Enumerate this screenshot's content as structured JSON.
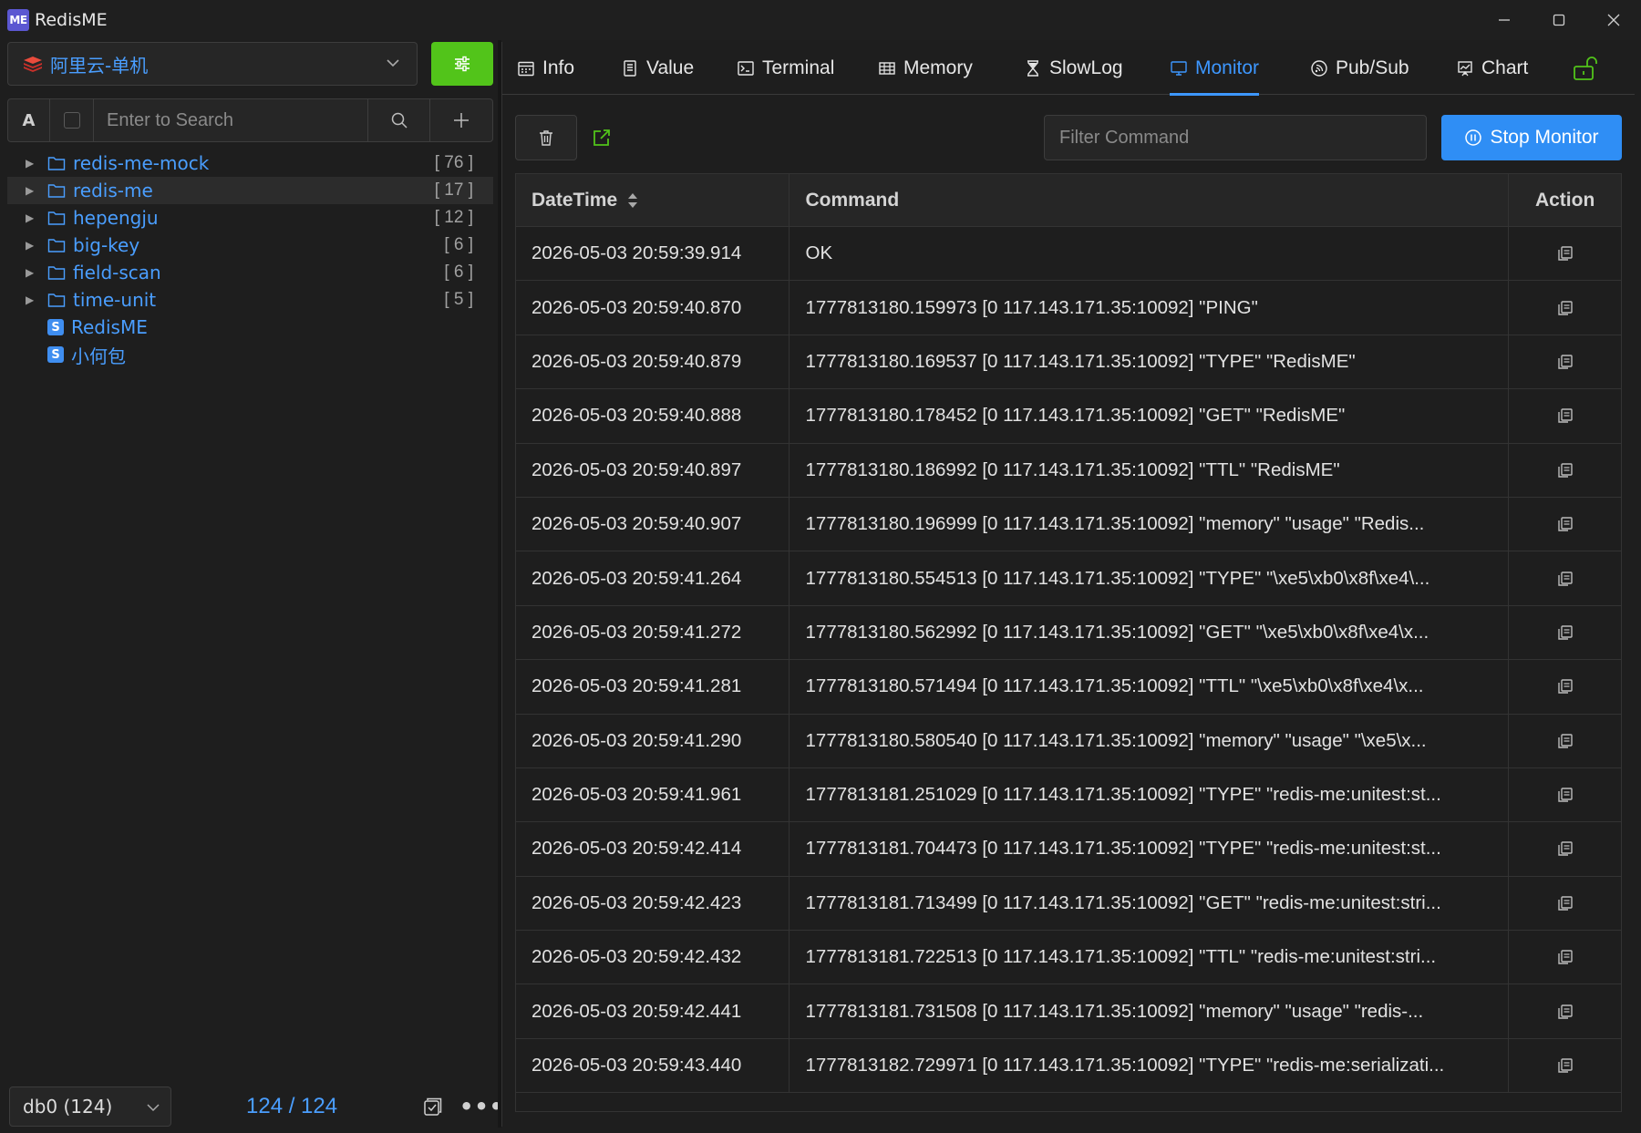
{
  "app": {
    "title": "RedisME",
    "logo_text": "ME"
  },
  "connection": {
    "label": "阿里云-单机"
  },
  "search": {
    "case_toggle": "A",
    "placeholder": "Enter to Search"
  },
  "tree": [
    {
      "type": "folder",
      "label": "redis-me-mock",
      "count": "[ 76 ]"
    },
    {
      "type": "folder",
      "label": "redis-me",
      "count": "[ 17 ]",
      "selected": true
    },
    {
      "type": "folder",
      "label": "hepengju",
      "count": "[ 12 ]"
    },
    {
      "type": "folder",
      "label": "big-key",
      "count": "[ 6 ]"
    },
    {
      "type": "folder",
      "label": "field-scan",
      "count": "[ 6 ]"
    },
    {
      "type": "folder",
      "label": "time-unit",
      "count": "[ 5 ]"
    },
    {
      "type": "string",
      "label": "RedisME",
      "badge": "S"
    },
    {
      "type": "string",
      "label": "小何包",
      "badge": "S"
    }
  ],
  "footer": {
    "db_label": "db0 (124)",
    "key_count": "124 / 124"
  },
  "tabs": [
    {
      "label": "Info",
      "icon": "calendar-icon"
    },
    {
      "label": "Value",
      "icon": "document-icon"
    },
    {
      "label": "Terminal",
      "icon": "terminal-icon"
    },
    {
      "label": "Memory",
      "icon": "memory-icon"
    },
    {
      "label": "SlowLog",
      "icon": "hourglass-icon"
    },
    {
      "label": "Monitor",
      "icon": "monitor-icon",
      "active": true
    },
    {
      "label": "Pub/Sub",
      "icon": "broadcast-icon"
    },
    {
      "label": "Chart",
      "icon": "chart-icon"
    }
  ],
  "monitor": {
    "filter_placeholder": "Filter Command",
    "stop_label": "Stop Monitor",
    "columns": {
      "datetime": "DateTime",
      "command": "Command",
      "action": "Action"
    },
    "rows": [
      {
        "datetime": "2026-05-03 20:59:39.914",
        "command": "OK"
      },
      {
        "datetime": "2026-05-03 20:59:40.870",
        "command": "1777813180.159973 [0 117.143.171.35:10092] \"PING\""
      },
      {
        "datetime": "2026-05-03 20:59:40.879",
        "command": "1777813180.169537 [0 117.143.171.35:10092] \"TYPE\" \"RedisME\""
      },
      {
        "datetime": "2026-05-03 20:59:40.888",
        "command": "1777813180.178452 [0 117.143.171.35:10092] \"GET\" \"RedisME\""
      },
      {
        "datetime": "2026-05-03 20:59:40.897",
        "command": "1777813180.186992 [0 117.143.171.35:10092] \"TTL\" \"RedisME\""
      },
      {
        "datetime": "2026-05-03 20:59:40.907",
        "command": "1777813180.196999 [0 117.143.171.35:10092] \"memory\" \"usage\" \"Redis..."
      },
      {
        "datetime": "2026-05-03 20:59:41.264",
        "command": "1777813180.554513 [0 117.143.171.35:10092] \"TYPE\" \"\\xe5\\xb0\\x8f\\xe4\\..."
      },
      {
        "datetime": "2026-05-03 20:59:41.272",
        "command": "1777813180.562992 [0 117.143.171.35:10092] \"GET\" \"\\xe5\\xb0\\x8f\\xe4\\x..."
      },
      {
        "datetime": "2026-05-03 20:59:41.281",
        "command": "1777813180.571494 [0 117.143.171.35:10092] \"TTL\" \"\\xe5\\xb0\\x8f\\xe4\\x..."
      },
      {
        "datetime": "2026-05-03 20:59:41.290",
        "command": "1777813180.580540 [0 117.143.171.35:10092] \"memory\" \"usage\" \"\\xe5\\x..."
      },
      {
        "datetime": "2026-05-03 20:59:41.961",
        "command": "1777813181.251029 [0 117.143.171.35:10092] \"TYPE\" \"redis-me:unitest:st..."
      },
      {
        "datetime": "2026-05-03 20:59:42.414",
        "command": "1777813181.704473 [0 117.143.171.35:10092] \"TYPE\" \"redis-me:unitest:st..."
      },
      {
        "datetime": "2026-05-03 20:59:42.423",
        "command": "1777813181.713499 [0 117.143.171.35:10092] \"GET\" \"redis-me:unitest:stri..."
      },
      {
        "datetime": "2026-05-03 20:59:42.432",
        "command": "1777813181.722513 [0 117.143.171.35:10092] \"TTL\" \"redis-me:unitest:stri..."
      },
      {
        "datetime": "2026-05-03 20:59:42.441",
        "command": "1777813181.731508 [0 117.143.171.35:10092] \"memory\" \"usage\" \"redis-..."
      },
      {
        "datetime": "2026-05-03 20:59:43.440",
        "command": "1777813182.729971 [0 117.143.171.35:10092] \"TYPE\" \"redis-me:serializati..."
      }
    ]
  },
  "colors": {
    "accent": "#3d97ff",
    "green": "#52c41a",
    "background": "#1e1e1e",
    "stop_button": "#2f8ef5"
  }
}
